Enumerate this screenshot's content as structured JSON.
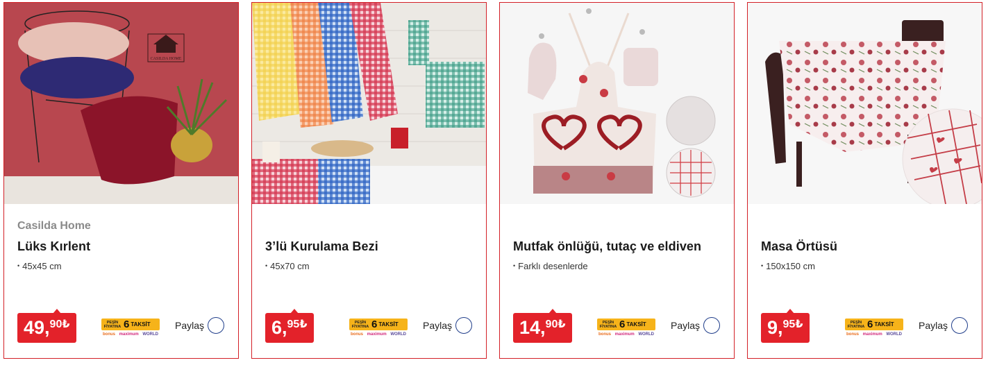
{
  "currency_symbol": "₺",
  "colors": {
    "accent": "#e3222a",
    "border": "#d31f26",
    "share_ring": "#1f3d8a",
    "taksit_bg": "#f6b31a"
  },
  "products": [
    {
      "brand": "Casilda Home",
      "title": "Lüks Kırlent",
      "spec": "45x45 cm",
      "price_int": "49,",
      "price_dec": "90",
      "taksit": {
        "small": "PEŞİN FİYATINA",
        "count": "6",
        "word": "TAKSİT",
        "bank1": "bonus",
        "bank2": "maximum",
        "bank3": "WORLD"
      },
      "share_label": "Paylaş"
    },
    {
      "brand": "",
      "title": "3’lü Kurulama Bezi",
      "spec": "45x70 cm",
      "price_int": "6,",
      "price_dec": "95",
      "taksit": {
        "small": "PEŞİN FİYATINA",
        "count": "6",
        "word": "TAKSİT",
        "bank1": "bonus",
        "bank2": "maximum",
        "bank3": "WORLD"
      },
      "share_label": "Paylaş"
    },
    {
      "brand": "",
      "title": "Mutfak önlüğü, tutaç ve eldiven",
      "spec": "Farklı desenlerde",
      "price_int": "14,",
      "price_dec": "90",
      "taksit": {
        "small": "PEŞİN FİYATINA",
        "count": "6",
        "word": "TAKSİT",
        "bank1": "bonus",
        "bank2": "maximum",
        "bank3": "WORLD"
      },
      "share_label": "Paylaş"
    },
    {
      "brand": "",
      "title": "Masa Örtüsü",
      "spec": "150x150 cm",
      "price_int": "9,",
      "price_dec": "95",
      "taksit": {
        "small": "PEŞİN FİYATINA",
        "count": "6",
        "word": "TAKSİT",
        "bank1": "bonus",
        "bank2": "maximum",
        "bank3": "WORLD"
      },
      "share_label": "Paylaş"
    }
  ],
  "image_logo_text": "CASILDA HOME"
}
